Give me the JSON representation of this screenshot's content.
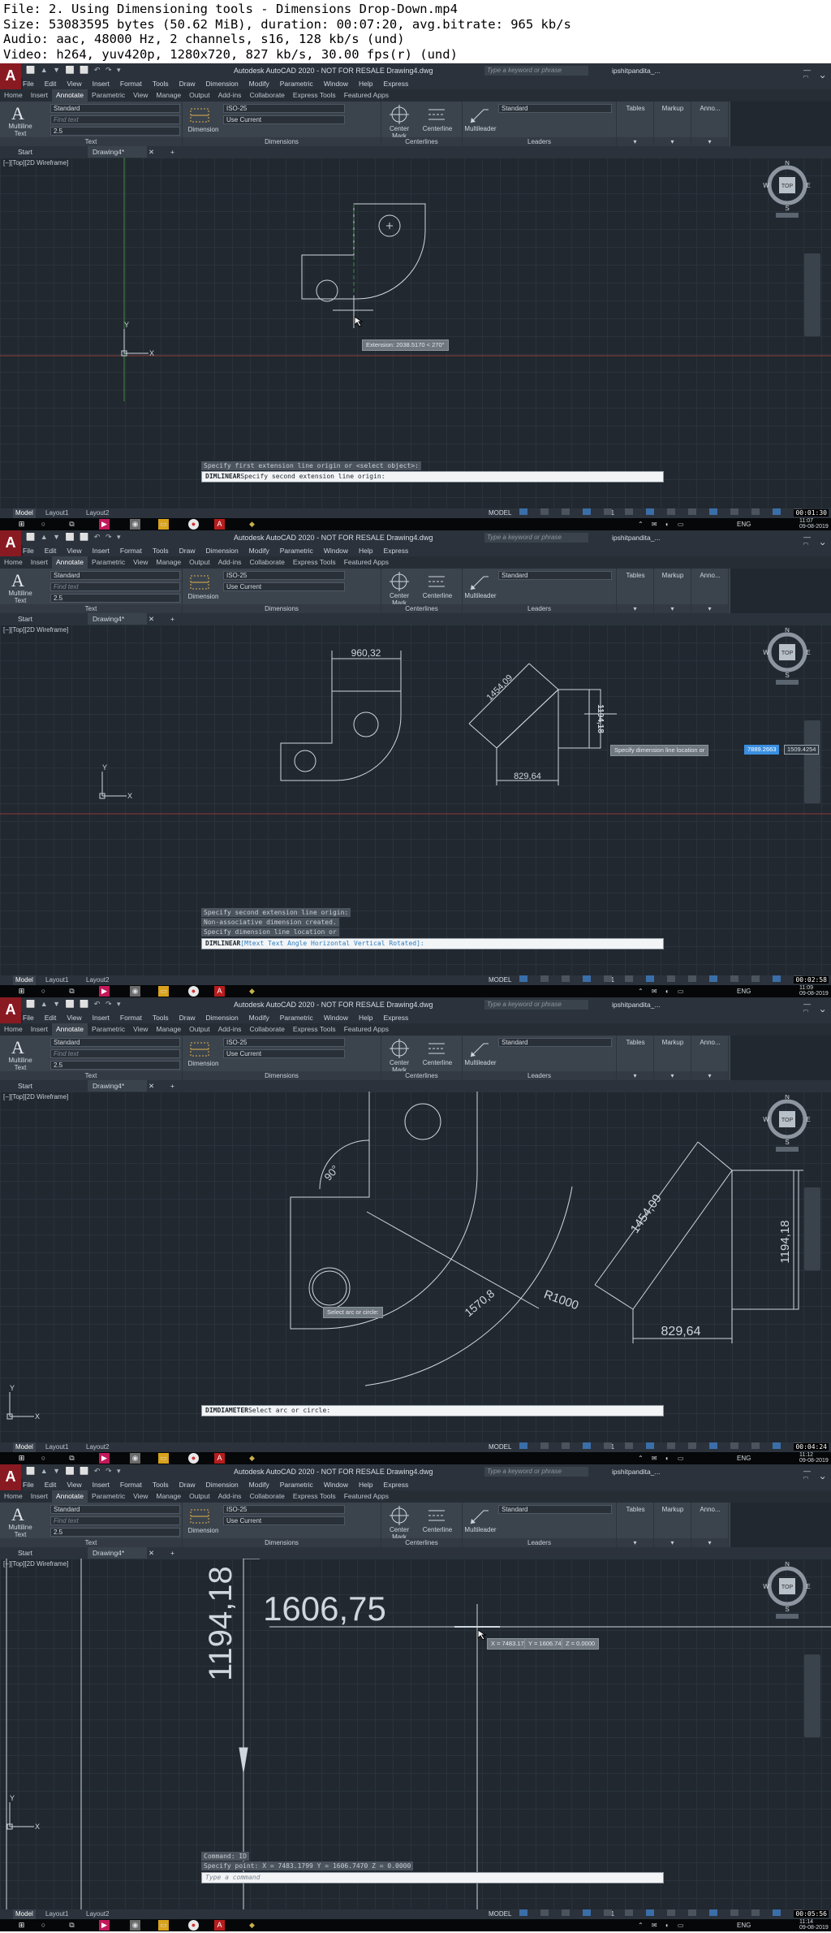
{
  "header": {
    "lines": [
      "File: 2. Using Dimensioning tools - Dimensions Drop-Down.mp4",
      "Size: 53083595 bytes (50.62 MiB), duration: 00:07:20, avg.bitrate: 965 kb/s",
      "Audio: aac, 48000 Hz, 2 channels, s16, 128 kb/s (und)",
      "Video: h264, yuv420p, 1280x720, 827 kb/s, 30.00 fps(r) (und)"
    ]
  },
  "app": {
    "logo": "A",
    "qat": "⬜ ▲ ▼ ⬜ ⬜ ↶ ↷ ▾",
    "window_title": "Autodesk AutoCAD 2020 - NOT FOR RESALE   Drawing4.dwg",
    "search_placeholder": "Type a keyword or phrase",
    "user": "ipshitpandita_...",
    "window_controls": "— □ ✕"
  },
  "menu": [
    "File",
    "Edit",
    "View",
    "Insert",
    "Format",
    "Tools",
    "Draw",
    "Dimension",
    "Modify",
    "Parametric",
    "Window",
    "Help",
    "Express"
  ],
  "ribbon_tabs": [
    "Home",
    "Insert",
    "Annotate",
    "Parametric",
    "View",
    "Manage",
    "Output",
    "Add-ins",
    "Collaborate",
    "Express Tools",
    "Featured Apps"
  ],
  "ribbon_active_tab": "Annotate",
  "ribbon": {
    "multiline_text": "Multiline Text",
    "text_style": "Standard",
    "find_text": "Find text",
    "text_height": "2.5",
    "text_panel": "Text",
    "dimension": "Dimension",
    "dim_style": "ISO-25",
    "use_current": "Use Current",
    "dimensions_panel": "Dimensions",
    "center_mark": "Center Mark",
    "centerline": "Centerline",
    "centerlines_panel": "Centerlines",
    "multileader": "Multileader",
    "leader_style": "Standard",
    "leaders_panel": "Leaders",
    "tables": "Tables",
    "markup": "Markup",
    "anno": "Anno..."
  },
  "file_tabs": {
    "start": "Start",
    "drawing": "Drawing4*",
    "close": "✕",
    "add": "+"
  },
  "viewport_label": "[−][Top][2D Wireframe]",
  "viewcube": {
    "top": "TOP",
    "n": "N",
    "s": "S",
    "e": "E",
    "w": "W",
    "wcs": "WCS"
  },
  "ucs": {
    "x": "X",
    "y": "Y"
  },
  "status": {
    "model": "Model",
    "layout1": "Layout1",
    "layout2": "Layout2",
    "model_button": "MODEL",
    "scale": "1:1",
    "lang": "ENG"
  },
  "screenshots": [
    {
      "tooltip": "Extension: 2038.5170 < 270°",
      "history": [
        "Specify first extension line origin or <select object>:"
      ],
      "command_prefix": "DIMLINEAR",
      "command": "Specify second extension line origin:",
      "time": "11:07",
      "date": "09-08-2019",
      "timecode": "00:01:30"
    },
    {
      "dims": {
        "top": "960,32",
        "diag": "1454,09",
        "vert": "1194,18",
        "bottom": "829,64"
      },
      "dyn_prompt": "Specify dimension line location or",
      "dyn_value1": "7889.2663",
      "dyn_value2": "1509.4254",
      "history": [
        "Specify second extension line origin:",
        "Non-associative dimension created.",
        "Specify dimension line location or"
      ],
      "command_prefix": "DIMLINEAR",
      "command": "[Mtext Text Angle Horizontal Vertical Rotated]:",
      "time": "11:09",
      "date": "09-08-2019",
      "timecode": "00:02:58"
    },
    {
      "dims": {
        "angle": "90°",
        "diag": "1454,09",
        "vert": "1194,18",
        "bottom": "829,64",
        "radius": "R1000",
        "arc": "1570,8"
      },
      "tooltip": "Select arc or circle:",
      "command_prefix": "DIMDIAMETER",
      "command": "Select arc or circle:",
      "time": "11:12",
      "date": "09-08-2019",
      "timecode": "00:04:24"
    },
    {
      "dims": {
        "vert": "1194,18",
        "horiz": "1606,75"
      },
      "coords": {
        "x": "X = 7483.1799",
        "y": "Y = 1606.7470",
        "z": "Z = 0.0000"
      },
      "history": [
        "Command: ID",
        "Specify point:  X = 7483.1799     Y = 1606.7470     Z = 0.0000"
      ],
      "command_placeholder": "Type a command",
      "time": "11:14",
      "date": "09-08-2019",
      "timecode": "00:05:56"
    }
  ]
}
